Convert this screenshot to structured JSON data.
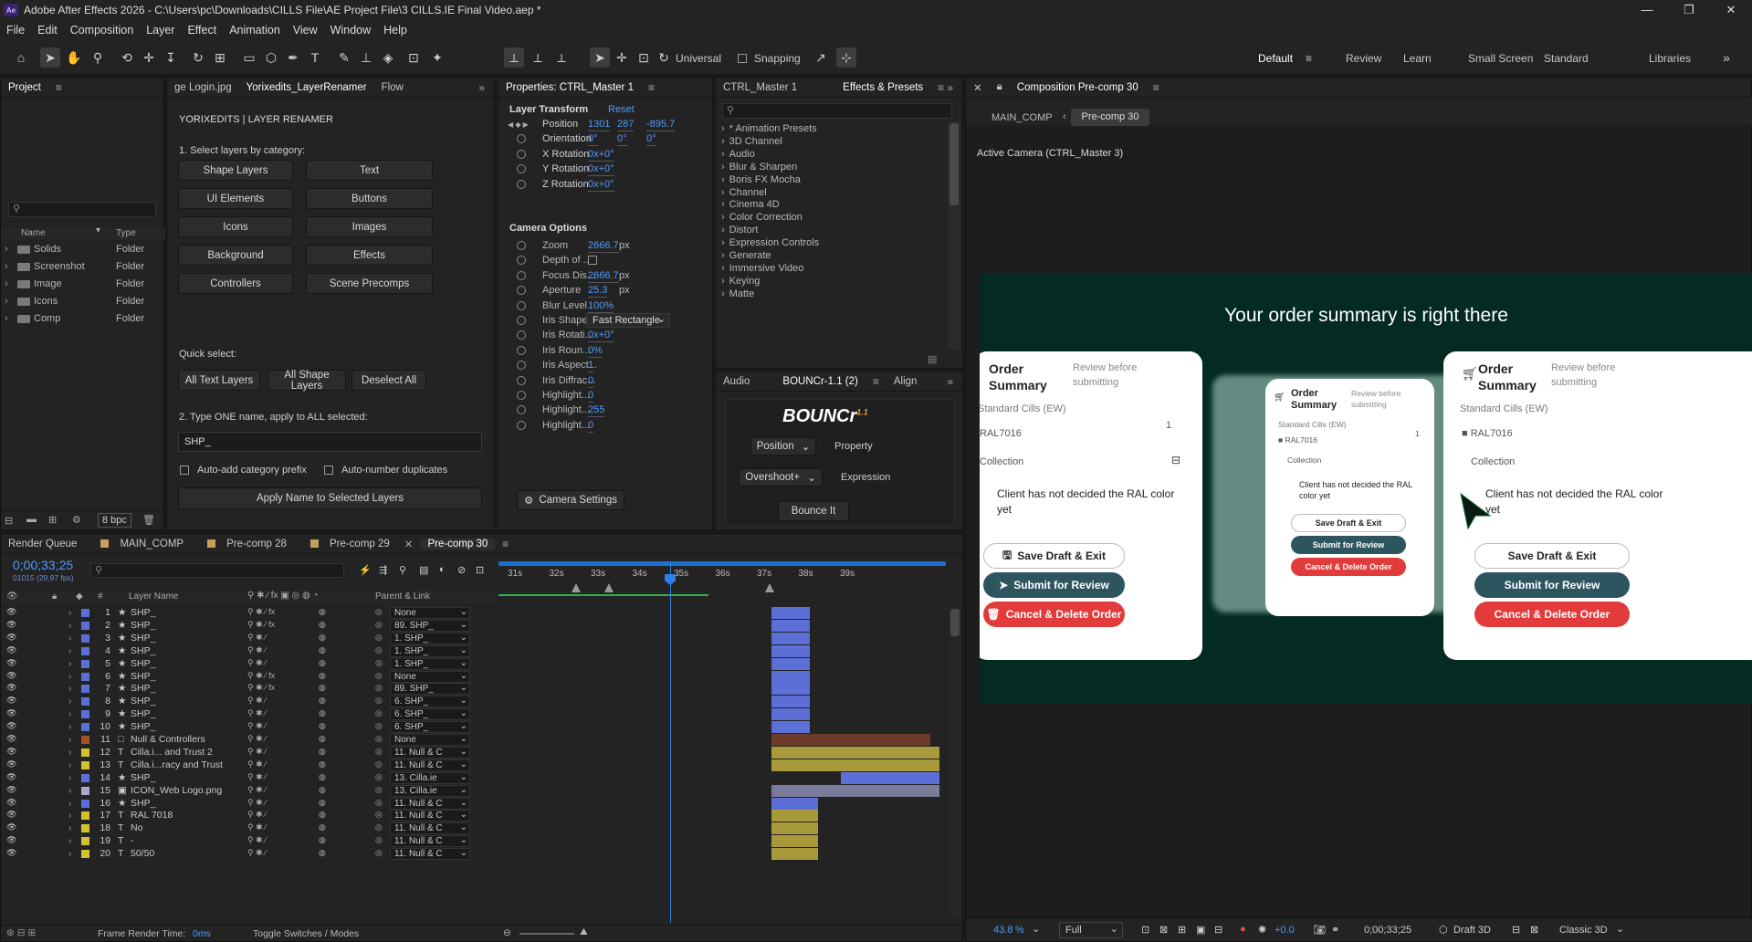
{
  "window": {
    "title": "Adobe After Effects 2026 - C:\\Users\\pc\\Downloads\\CILLS File\\AE Project File\\3 CILLS.IE Final Video.aep *",
    "logo": "Ae"
  },
  "menu": [
    "File",
    "Edit",
    "Composition",
    "Layer",
    "Effect",
    "Animation",
    "View",
    "Window",
    "Help"
  ],
  "toolbar": {
    "universal": "Universal",
    "snapping": "Snapping"
  },
  "workspaces": [
    "Default",
    "Review",
    "Learn",
    "Small Screen",
    "Standard",
    "Libraries"
  ],
  "project": {
    "tab": "Project",
    "col_name": "Name",
    "col_type": "Type",
    "items": [
      {
        "name": "Solids",
        "type": "Folder"
      },
      {
        "name": "Screenshot",
        "type": "Folder"
      },
      {
        "name": "Image",
        "type": "Folder"
      },
      {
        "name": "Icons",
        "type": "Folder"
      },
      {
        "name": "Comp",
        "type": "Folder"
      }
    ],
    "bpc": "8 bpc"
  },
  "renamer": {
    "tabs": [
      "ge Login.jpg",
      "Yorixedits_LayerRenamer",
      "Flow"
    ],
    "header": "YORIXEDITS  |  LAYER RENAMER",
    "step1": "1. Select layers by category:",
    "cats": [
      "Shape Layers",
      "Text",
      "UI Elements",
      "Buttons",
      "Icons",
      "Images",
      "Background",
      "Effects",
      "Controllers",
      "Scene Precomps"
    ],
    "quick": "Quick select:",
    "quick_btns": [
      "All Text Layers",
      "All Shape Layers",
      "Deselect All"
    ],
    "step2": "2. Type ONE name, apply to ALL selected:",
    "name_value": "SHP_",
    "opt1": "Auto-add category prefix",
    "opt2": "Auto-number duplicates",
    "apply": "Apply Name to Selected Layers"
  },
  "props": {
    "tab": "Properties: CTRL_Master 1",
    "section1": "Layer Transform",
    "reset": "Reset",
    "position": {
      "label": "Position",
      "x": "1301",
      "y": "287",
      "z": "-895.7"
    },
    "orientation": {
      "label": "Orientation",
      "x": "0°",
      "y": "0°",
      "z": "0°"
    },
    "xrot": {
      "label": "X Rotation",
      "v": "0x+0°"
    },
    "yrot": {
      "label": "Y Rotation",
      "v": "0x+0°"
    },
    "zrot": {
      "label": "Z Rotation",
      "v": "0x+0°"
    },
    "section2": "Camera Options",
    "cam": [
      {
        "label": "Zoom",
        "v": "2666.7",
        "u": "px"
      },
      {
        "label": "Depth of ...",
        "v": "",
        "u": ""
      },
      {
        "label": "Focus Dis...",
        "v": "2666.7",
        "u": "px"
      },
      {
        "label": "Aperture",
        "v": "25.3",
        "u": "px"
      },
      {
        "label": "Blur Level",
        "v": "100%",
        "u": ""
      },
      {
        "label": "Iris Shape",
        "v": "Fast Rectangle",
        "u": ""
      },
      {
        "label": "Iris Rotati...",
        "v": "0x+0°",
        "u": ""
      },
      {
        "label": "Iris Roun...",
        "v": "0%",
        "u": ""
      },
      {
        "label": "Iris Aspect...",
        "v": "1",
        "u": ""
      },
      {
        "label": "Iris Diffrac...",
        "v": "0",
        "u": ""
      },
      {
        "label": "Highlight...",
        "v": "0",
        "u": ""
      },
      {
        "label": "Highlight...",
        "v": "255",
        "u": ""
      },
      {
        "label": "Highlight...",
        "v": "0",
        "u": ""
      }
    ],
    "camera_settings": "Camera Settings"
  },
  "effects": {
    "tab1": "CTRL_Master 1",
    "tab2": "Effects & Presets",
    "items": [
      "* Animation Presets",
      "3D Channel",
      "Audio",
      "Blur & Sharpen",
      "Boris FX Mocha",
      "Channel",
      "Cinema 4D",
      "Color Correction",
      "Distort",
      "Expression Controls",
      "Generate",
      "Immersive Video",
      "Keying",
      "Matte"
    ]
  },
  "bouncr": {
    "tabs": [
      "Audio",
      "BOUNCr-1.1 (2)",
      "Align"
    ],
    "logo": "BOUNCr",
    "ver": "1.1",
    "sel1": "Position",
    "lbl1": "Property",
    "sel2": "Overshoot+",
    "lbl2": "Expression",
    "btn": "Bounce It"
  },
  "comp": {
    "tab": "Composition Pre-comp 30",
    "crumb1": "MAIN_COMP",
    "crumb2": "Pre-comp 30",
    "camera": "Active Camera (CTRL_Master 3)",
    "headline": "Your order summary is right there",
    "zoom": "43.8",
    "zoom_unit": "%",
    "quality": "Full",
    "exposure": "+0.0",
    "time": "0;00;33;25",
    "renderer": "Draft 3D",
    "mode": "Classic 3D"
  },
  "card": {
    "title": "Order Summary",
    "review": "Review before submitting",
    "item": "Standard Cills (EW)",
    "qty": "1",
    "ral": "RAL7016",
    "collection": "Collection",
    "note": "Client has not decided the RAL color yet",
    "save": "Save Draft & Exit",
    "submit": "Submit for Review",
    "cancel": "Cancel & Delete Order"
  },
  "timeline": {
    "tabs": [
      "Render Queue",
      "MAIN_COMP",
      "Pre-comp 28",
      "Pre-comp 29",
      "Pre-comp 30"
    ],
    "time": "0;00;33;25",
    "fps": "01015 (29.97 fps)",
    "col_layer": "Layer Name",
    "col_parent": "Parent & Link",
    "ticks": [
      "31s",
      "32s",
      "33s",
      "34s",
      "35s",
      "36s",
      "37s",
      "38s",
      "39s"
    ],
    "render_time_label": "Frame Render Time:",
    "render_time": "0ms",
    "toggle": "Toggle Switches / Modes",
    "layers": [
      {
        "n": "1",
        "type": "★",
        "name": "SHP_",
        "parent": "None",
        "color": "#5b6fd6",
        "fx": true,
        "bs": 0.61,
        "be": 0.695,
        "bc": "#5b6fd6"
      },
      {
        "n": "2",
        "type": "★",
        "name": "SHP_",
        "parent": "89. SHP_",
        "color": "#5b6fd6",
        "fx": true,
        "bs": 0.61,
        "be": 0.695,
        "bc": "#5b6fd6"
      },
      {
        "n": "3",
        "type": "★",
        "name": "SHP_",
        "parent": "1. SHP_",
        "color": "#5b6fd6",
        "fx": false,
        "bs": 0.61,
        "be": 0.695,
        "bc": "#5b6fd6"
      },
      {
        "n": "4",
        "type": "★",
        "name": "SHP_",
        "parent": "1. SHP_",
        "color": "#5b6fd6",
        "fx": false,
        "bs": 0.61,
        "be": 0.695,
        "bc": "#5b6fd6"
      },
      {
        "n": "5",
        "type": "★",
        "name": "SHP_",
        "parent": "1. SHP_",
        "color": "#5b6fd6",
        "fx": false,
        "bs": 0.61,
        "be": 0.695,
        "bc": "#5b6fd6"
      },
      {
        "n": "6",
        "type": "★",
        "name": "SHP_",
        "parent": "None",
        "color": "#5b6fd6",
        "fx": true,
        "bs": 0.61,
        "be": 0.695,
        "bc": "#5b6fd6"
      },
      {
        "n": "7",
        "type": "★",
        "name": "SHP_",
        "parent": "89. SHP_",
        "color": "#5b6fd6",
        "fx": true,
        "bs": 0.61,
        "be": 0.695,
        "bc": "#5b6fd6"
      },
      {
        "n": "8",
        "type": "★",
        "name": "SHP_",
        "parent": "6. SHP_",
        "color": "#5b6fd6",
        "fx": false,
        "bs": 0.61,
        "be": 0.695,
        "bc": "#5b6fd6"
      },
      {
        "n": "9",
        "type": "★",
        "name": "SHP_",
        "parent": "6. SHP_",
        "color": "#5b6fd6",
        "fx": false,
        "bs": 0.61,
        "be": 0.695,
        "bc": "#5b6fd6"
      },
      {
        "n": "10",
        "type": "★",
        "name": "SHP_",
        "parent": "6. SHP_",
        "color": "#5b6fd6",
        "fx": false,
        "bs": 0.61,
        "be": 0.695,
        "bc": "#5b6fd6"
      },
      {
        "n": "11",
        "type": "□",
        "name": "Null & Controllers",
        "parent": "None",
        "color": "#a0522d",
        "fx": false,
        "bs": 0.61,
        "be": 0.965,
        "bc": "#6e3a2a"
      },
      {
        "n": "12",
        "type": "T",
        "name": "Cilla.i... and Trust 2",
        "parent": "11. Null & C",
        "color": "#d4c030",
        "fx": false,
        "bs": 0.61,
        "be": 0.985,
        "bc": "#a89a3c"
      },
      {
        "n": "13",
        "type": "T",
        "name": "Cilla.i...racy and Trust",
        "parent": "11. Null & C",
        "color": "#d4c030",
        "fx": false,
        "bs": 0.61,
        "be": 0.985,
        "bc": "#a89a3c"
      },
      {
        "n": "14",
        "type": "★",
        "name": "SHP_",
        "parent": "13. Cilla.ie",
        "color": "#5b6fd6",
        "fx": false,
        "bs": 0.765,
        "be": 0.985,
        "bc": "#5b6fd6"
      },
      {
        "n": "15",
        "type": "▣",
        "name": "ICON_Web Logo.png",
        "parent": "13. Cilla.ie",
        "color": "#a8a8c8",
        "fx": false,
        "bs": 0.61,
        "be": 0.985,
        "bc": "#7a7a9a"
      },
      {
        "n": "16",
        "type": "★",
        "name": "SHP_",
        "parent": "11. Null & C",
        "color": "#5b6fd6",
        "fx": false,
        "bs": 0.61,
        "be": 0.715,
        "bc": "#5b6fd6"
      },
      {
        "n": "17",
        "type": "T",
        "name": "RAL 7018",
        "parent": "11. Null & C",
        "color": "#d4c030",
        "fx": false,
        "bs": 0.61,
        "be": 0.715,
        "bc": "#a89a3c"
      },
      {
        "n": "18",
        "type": "T",
        "name": "No",
        "parent": "11. Null & C",
        "color": "#d4c030",
        "fx": false,
        "bs": 0.61,
        "be": 0.715,
        "bc": "#a89a3c"
      },
      {
        "n": "19",
        "type": "T",
        "name": "-",
        "parent": "11. Null & C",
        "color": "#d4c030",
        "fx": false,
        "bs": 0.61,
        "be": 0.715,
        "bc": "#a89a3c"
      },
      {
        "n": "20",
        "type": "T",
        "name": "50/50",
        "parent": "11. Null & C",
        "color": "#d4c030",
        "fx": false,
        "bs": 0.61,
        "be": 0.715,
        "bc": "#a89a3c"
      }
    ]
  }
}
